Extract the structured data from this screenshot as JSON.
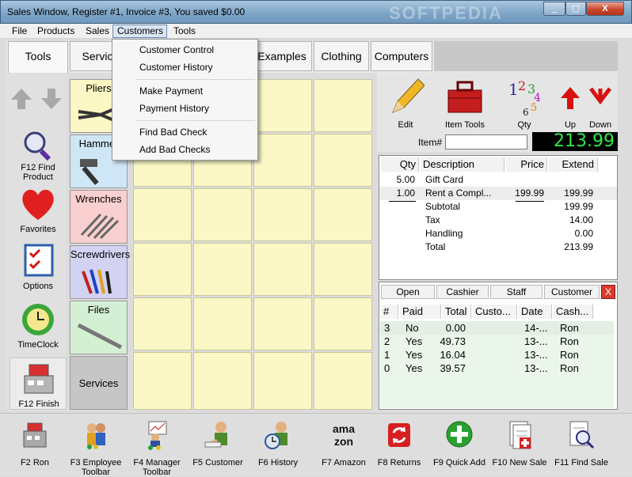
{
  "window": {
    "title": "Sales Window,  Register #1,  Invoice #3, You saved $0.00",
    "watermark": "SOFTPEDIA",
    "min": "_",
    "max": "▢",
    "close": "X"
  },
  "menubar": {
    "items": [
      "File",
      "Products",
      "Sales",
      "Customers",
      "Tools"
    ]
  },
  "tabs": [
    "Tools",
    "Servic",
    "Examples",
    "Clothing",
    "Computers"
  ],
  "left_buttons": [
    {
      "label": "F12 Find Product",
      "icon": "magnifier-icon"
    },
    {
      "label": "Favorites",
      "icon": "heart-icon"
    },
    {
      "label": "Options",
      "icon": "checklist-icon"
    },
    {
      "label": "TimeClock",
      "icon": "clock-icon"
    },
    {
      "label": "F12 Finish",
      "icon": "cash-register-icon"
    }
  ],
  "categories": [
    {
      "label": "Pliers",
      "color": "#fbf8c5"
    },
    {
      "label": "Hammer",
      "color": "#cfe6f6"
    },
    {
      "label": "Wrenches",
      "color": "#f9cfcf"
    },
    {
      "label": "Screwdrivers",
      "color": "#d2d2f2"
    },
    {
      "label": "Files",
      "color": "#d4f0d4"
    },
    {
      "label": "Services",
      "color": "#c6c6c6"
    }
  ],
  "right_toolbar": {
    "edit": "Edit",
    "item_tools": "Item Tools",
    "qty": "Qty",
    "up": "Up",
    "down": "Down",
    "item_label": "Item#",
    "total": "213.99"
  },
  "invoice": {
    "headers": [
      "Qty",
      "Description",
      "Price",
      "Extend"
    ],
    "rows": [
      {
        "qty": "5.00",
        "desc": "Gift Card",
        "price": "",
        "extend": ""
      },
      {
        "qty": "1.00",
        "desc": "Rent a Compl...",
        "price": "199.99",
        "extend": "199.99"
      }
    ],
    "summary": [
      {
        "label": "Subtotal",
        "value": "199.99"
      },
      {
        "label": "Tax",
        "value": "14.00"
      },
      {
        "label": "Handling",
        "value": "0.00"
      },
      {
        "label": "Total",
        "value": "213.99"
      }
    ]
  },
  "invoices_panel": {
    "tabs": [
      "Open",
      "Cashier",
      "Staff",
      "Customer"
    ],
    "close": "X",
    "headers": [
      "#",
      "Paid",
      "Total",
      "Custo...",
      "Date",
      "Cash..."
    ],
    "rows": [
      {
        "num": "3",
        "paid": "No",
        "total": "0.00",
        "date": "14-...",
        "cashier": "Ron"
      },
      {
        "num": "2",
        "paid": "Yes",
        "total": "49.73",
        "date": "13-...",
        "cashier": "Ron"
      },
      {
        "num": "1",
        "paid": "Yes",
        "total": "16.04",
        "date": "13-...",
        "cashier": "Ron"
      },
      {
        "num": "0",
        "paid": "Yes",
        "total": "39.57",
        "date": "13-...",
        "cashier": "Ron"
      }
    ]
  },
  "bottom_buttons": [
    {
      "label": "F2 Ron",
      "icon": "cash-register-icon"
    },
    {
      "label": "F3 Employee Toolbar",
      "icon": "employee-icon"
    },
    {
      "label": "F4 Manager Toolbar",
      "icon": "manager-icon"
    },
    {
      "label": "F5 Customer",
      "icon": "customer-icon"
    },
    {
      "label": "F6 History",
      "icon": "history-icon"
    },
    {
      "label": "F7 Amazon",
      "icon": "amazon-icon",
      "icon_text": "amazon"
    },
    {
      "label": "F8 Returns",
      "icon": "returns-icon"
    },
    {
      "label": "F9 Quick Add",
      "icon": "quick-add-icon"
    },
    {
      "label": "F10 New Sale",
      "icon": "new-sale-icon"
    },
    {
      "label": "F11 Find Sale",
      "icon": "find-sale-icon"
    }
  ],
  "dropdown": {
    "items": [
      "Customer Control",
      "Customer History",
      "Make Payment",
      "Payment History",
      "Find Bad Check",
      "Add Bad Checks"
    ]
  }
}
